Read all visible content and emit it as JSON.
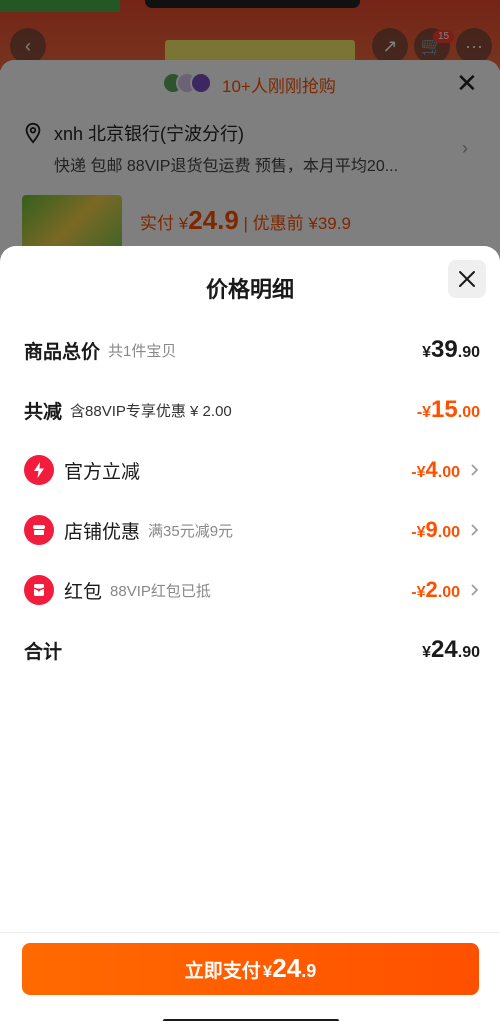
{
  "background": {
    "cart_count": "15",
    "recent_buyers": "10+人刚刚抢购",
    "address_title": "xnh 北京银行(宁波分行)",
    "address_sub": "快递 包邮 88VIP退货包运费 预售，本月平均20...",
    "price_prefix": "实付 ¥",
    "price_value": "24.9",
    "price_before": "| 优惠前 ¥39.9"
  },
  "sheet": {
    "title": "价格明细",
    "rows": [
      {
        "label": "商品总价",
        "sub": "共1件宝贝",
        "yen": "¥",
        "int": "39",
        "dec": ".90"
      },
      {
        "label": "共减",
        "sub": "含88VIP专享优惠 ¥ 2.00",
        "yen": "-¥",
        "int": "15",
        "dec": ".00"
      },
      {
        "label": "官方立减",
        "sub": "",
        "yen": "-¥",
        "int": "4",
        "dec": ".00",
        "icon": "lightning-icon"
      },
      {
        "label": "店铺优惠",
        "sub": "满35元减9元",
        "yen": "-¥",
        "int": "9",
        "dec": ".00",
        "icon": "shop-icon"
      },
      {
        "label": "红包",
        "sub": "88VIP红包已抵",
        "yen": "-¥",
        "int": "2",
        "dec": ".00",
        "icon": "red-packet-icon"
      },
      {
        "label": "合计",
        "sub": "",
        "yen": "¥",
        "int": "24",
        "dec": ".90"
      }
    ]
  },
  "pay_button": {
    "label": "立即支付",
    "yen": "¥",
    "int": "24",
    "dec": ".9"
  },
  "colors": {
    "accent": "#ff5000",
    "icon_red": "#f21d3c"
  }
}
